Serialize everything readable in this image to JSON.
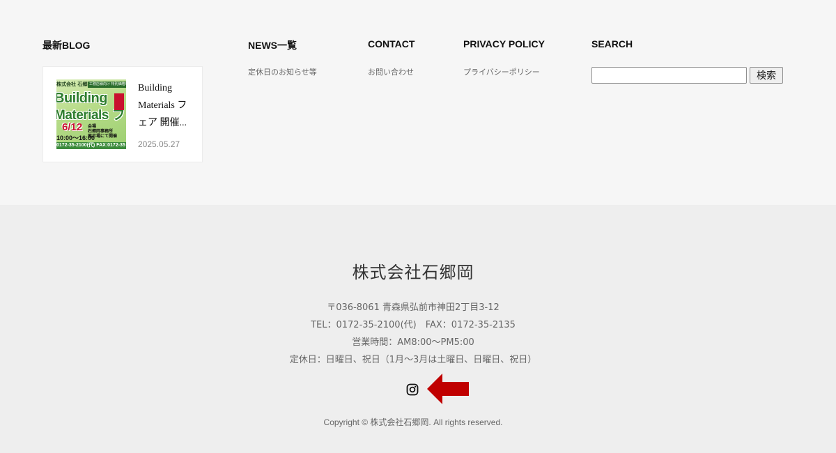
{
  "footer_widgets": {
    "blog": {
      "title": "最新BLOG",
      "post": {
        "title": "Building Materials フェア 開催...",
        "date": "2025.05.27",
        "thumbnail": {
          "company": "株式会社 石郷岡",
          "badge": "工務店様向け 特別価格!!",
          "line1": "Building",
          "line2": "Materials フ",
          "date": "6/12",
          "time": "10:00〜16:00",
          "venue_label": "会場",
          "venue": "石郷岡事務所",
          "venue2": "展示場にて開催",
          "tel": "0172-35-2100(代)  FAX:0172-35"
        }
      }
    },
    "news": {
      "title": "NEWS一覧",
      "link": "定休日のお知らせ等"
    },
    "contact": {
      "title": "CONTACT",
      "link": "お問い合わせ"
    },
    "privacy": {
      "title": "PRIVACY POLICY",
      "link": "プライバシーポリシー"
    },
    "search": {
      "title": "SEARCH",
      "input_value": "",
      "button_label": "検索"
    }
  },
  "company_info": {
    "name": "株式会社石郷岡",
    "address": "〒036-8061 青森県弘前市神田2丁目3-12",
    "tel_fax": "TEL：0172-35-2100(代)　FAX：0172-35-2135",
    "hours": "営業時間：AM8:00〜PM5:00",
    "holidays": "定休日：日曜日、祝日（1月〜3月は土曜日、日曜日、祝日）",
    "social_icon": "instagram-icon",
    "annotation_icon": "red-arrow-left",
    "copyright": "Copyright © 株式会社石郷岡. All rights reserved."
  },
  "colors": {
    "top_bg": "#f6f6f6",
    "bottom_bg": "#eeeeee",
    "arrow": "#c00000"
  }
}
